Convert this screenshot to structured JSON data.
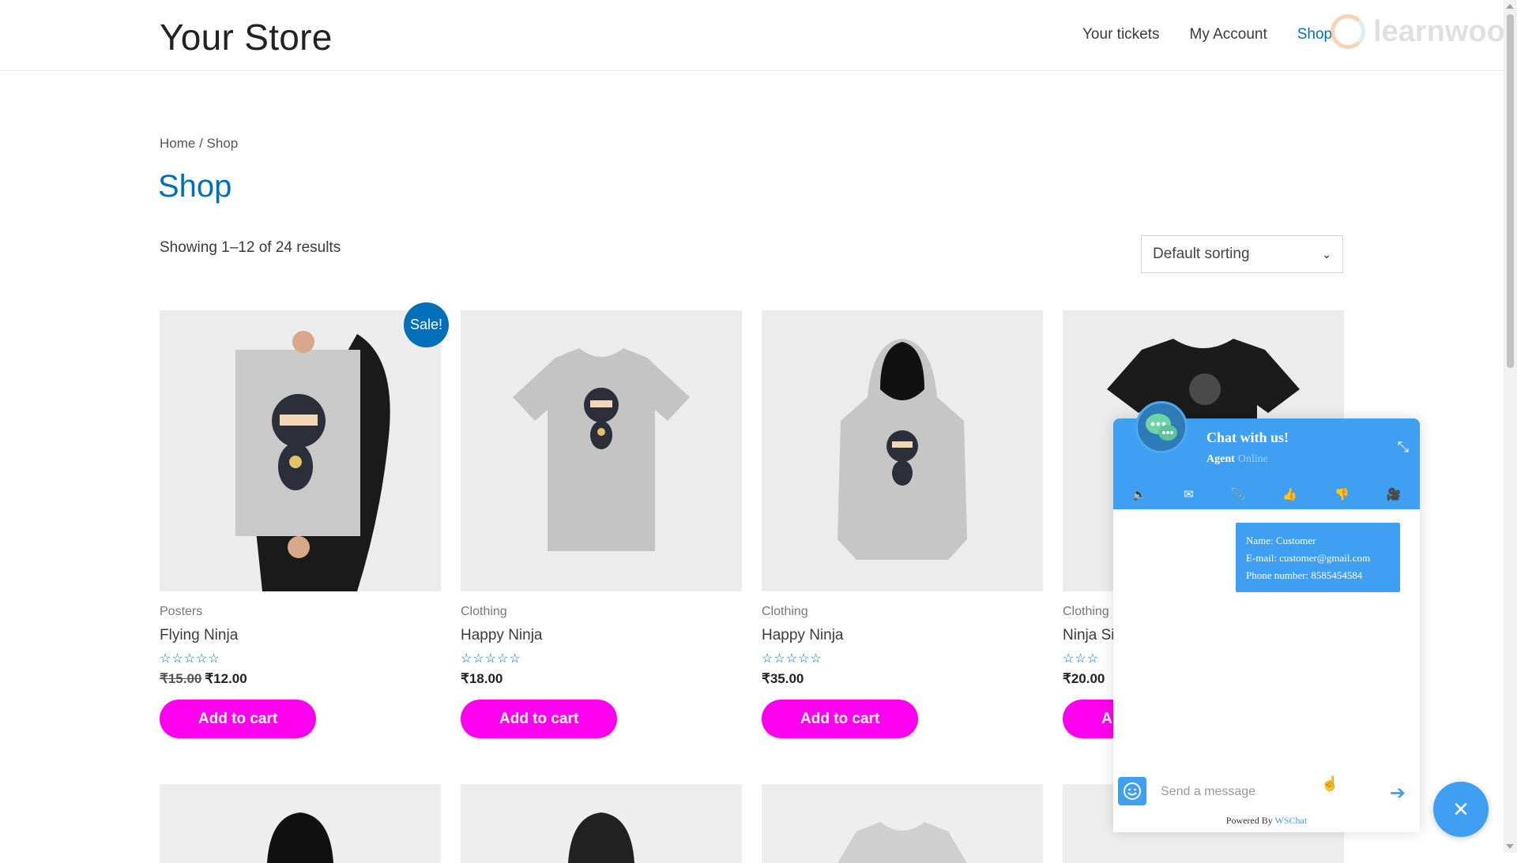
{
  "site": {
    "title": "Your Store"
  },
  "nav": {
    "items": [
      {
        "label": "Your tickets",
        "active": false
      },
      {
        "label": "My Account",
        "active": false
      },
      {
        "label": "Shop",
        "active": true
      }
    ]
  },
  "watermark": {
    "text": "learnwoo"
  },
  "breadcrumb": {
    "home": "Home",
    "separator": " / ",
    "current": "Shop"
  },
  "page": {
    "title": "Shop",
    "result_count": "Showing 1–12 of 24 results"
  },
  "sorting": {
    "selected": "Default sorting"
  },
  "products": [
    {
      "category": "Posters",
      "name": "Flying Ninja",
      "old_price": "₹15.00",
      "price": "₹12.00",
      "badge": "Sale!",
      "button": "Add to cart",
      "stars": "☆☆☆☆☆"
    },
    {
      "category": "Clothing",
      "name": "Happy Ninja",
      "old_price": "",
      "price": "₹18.00",
      "badge": "",
      "button": "Add to cart",
      "stars": "☆☆☆☆☆"
    },
    {
      "category": "Clothing",
      "name": "Happy Ninja",
      "old_price": "",
      "price": "₹35.00",
      "badge": "",
      "button": "Add to cart",
      "stars": "☆☆☆☆☆"
    },
    {
      "category": "Clothing",
      "name": "Ninja Si",
      "old_price": "",
      "price": "₹20.00",
      "badge": "",
      "button": "A",
      "stars": "☆☆☆"
    }
  ],
  "chat": {
    "title": "Chat with us!",
    "agent_label": "Agent",
    "agent_status": "Online",
    "message_lines": [
      "Name: Customer",
      "E-mail: customer@gmail.com",
      "Phone number: 8585454584"
    ],
    "input_placeholder": "Send a message",
    "footer_prefix": "Powered By ",
    "footer_brand": "WSChat",
    "tools": [
      "speaker-icon",
      "mail-icon",
      "attachment-icon",
      "thumbs-up-icon",
      "thumbs-down-icon",
      "video-icon"
    ],
    "accent_color": "#3f9ff2"
  },
  "colors": {
    "brand": "#0170b9",
    "button": "#ff00ee"
  }
}
